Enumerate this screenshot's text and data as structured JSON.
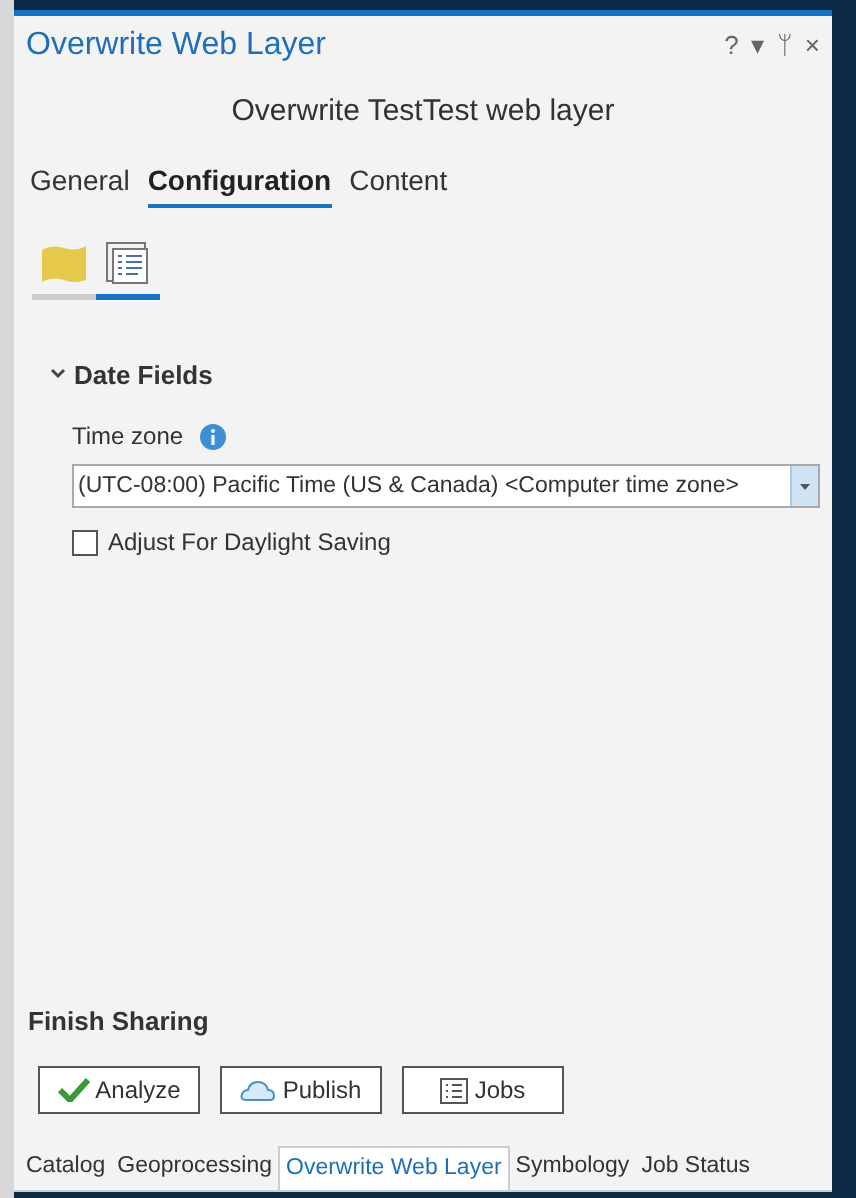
{
  "pane": {
    "title": "Overwrite Web Layer",
    "controls": [
      "?",
      "▾",
      "ᛘ",
      "×"
    ]
  },
  "subtitle": "Overwrite TestTest web layer",
  "tabs": [
    {
      "label": "General",
      "selected": false
    },
    {
      "label": "Configuration",
      "selected": true
    },
    {
      "label": "Content",
      "selected": false
    }
  ],
  "subtabs": [
    {
      "kind": "layers",
      "selected": false
    },
    {
      "kind": "properties",
      "selected": true
    }
  ],
  "section": {
    "title": "Date Fields",
    "expanded": true,
    "time_zone": {
      "label": "Time zone",
      "value": "(UTC-08:00) Pacific Time (US & Canada) <Computer time zone>"
    },
    "daylight": {
      "label": "Adjust For Daylight Saving",
      "checked": false
    }
  },
  "finish": {
    "title": "Finish Sharing",
    "buttons": [
      {
        "kind": "analyze",
        "label": "Analyze"
      },
      {
        "kind": "publish",
        "label": "Publish"
      },
      {
        "kind": "jobs",
        "label": "Jobs"
      }
    ]
  },
  "bottom_tabs": [
    {
      "label": "Catalog",
      "selected": false
    },
    {
      "label": "Geoprocessing",
      "selected": false
    },
    {
      "label": "Overwrite Web Layer",
      "selected": true
    },
    {
      "label": "Symbology",
      "selected": false
    },
    {
      "label": "Job Status",
      "selected": false
    }
  ]
}
